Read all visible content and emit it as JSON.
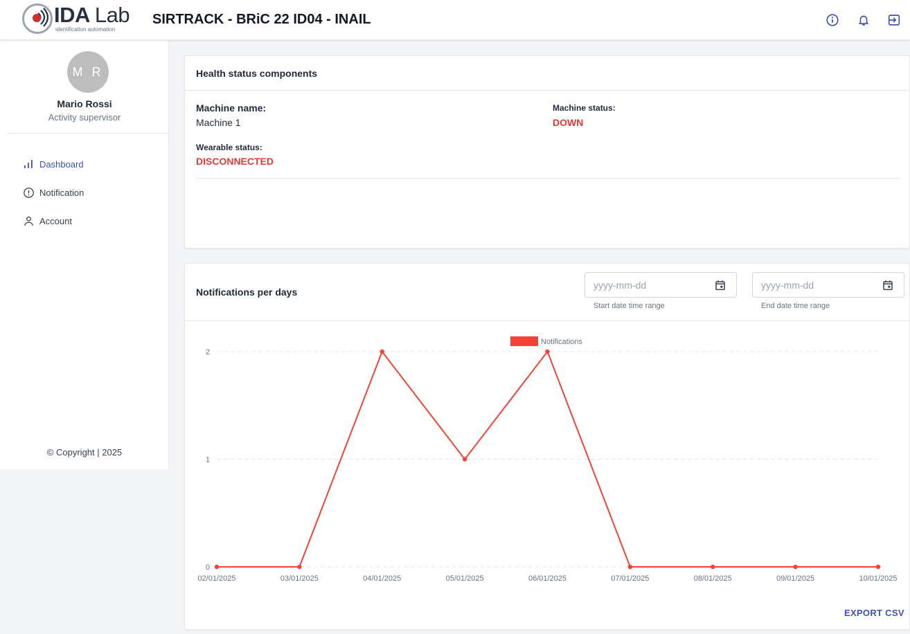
{
  "header": {
    "logo_brand": "IDA",
    "logo_brand_lab": "Lab",
    "logo_tagline": "identification automation",
    "title": "SIRTRACK - BRiC 22 ID04 - INAIL",
    "icons": [
      "info-icon",
      "bell-icon",
      "logout-icon"
    ]
  },
  "sidebar": {
    "avatar_initials": "M R",
    "user_name": "Mario Rossi",
    "user_role": "Activity supervisor",
    "items": [
      {
        "label": "Dashboard",
        "icon": "bar-chart-icon",
        "active": true
      },
      {
        "label": "Notification",
        "icon": "alert-circle-icon",
        "active": false
      },
      {
        "label": "Account",
        "icon": "user-icon",
        "active": false
      }
    ],
    "copyright": "© Copyright | 2025"
  },
  "health": {
    "title": "Health status components",
    "machine_name_label": "Machine name:",
    "machine_name_value": "Machine 1",
    "machine_status_label": "Machine status:",
    "machine_status_value": "DOWN",
    "wearable_status_label": "Wearable status:",
    "wearable_status_value": "DISCONNECTED"
  },
  "notifications": {
    "title": "Notifications per days",
    "start_date": {
      "placeholder": "yyyy-mm-dd",
      "helper": "Start date time range"
    },
    "end_date": {
      "placeholder": "yyyy-mm-dd",
      "helper": "End date time range"
    },
    "export_label": "EXPORT CSV"
  },
  "colors": {
    "accent": "#3f51b5",
    "alert": "#e53935",
    "series": "#f44336"
  },
  "chart_data": {
    "type": "line",
    "categories": [
      "02/01/2025",
      "03/01/2025",
      "04/01/2025",
      "05/01/2025",
      "06/01/2025",
      "07/01/2025",
      "08/01/2025",
      "09/01/2025",
      "10/01/2025"
    ],
    "series": [
      {
        "name": "Notifications",
        "values": [
          0,
          0,
          2,
          1,
          2,
          0,
          0,
          0,
          0
        ]
      }
    ],
    "y_ticks": [
      "0",
      "1",
      "2"
    ],
    "ylim": [
      0,
      2
    ],
    "legend": "top-center",
    "grid": "horizontal dashed"
  }
}
